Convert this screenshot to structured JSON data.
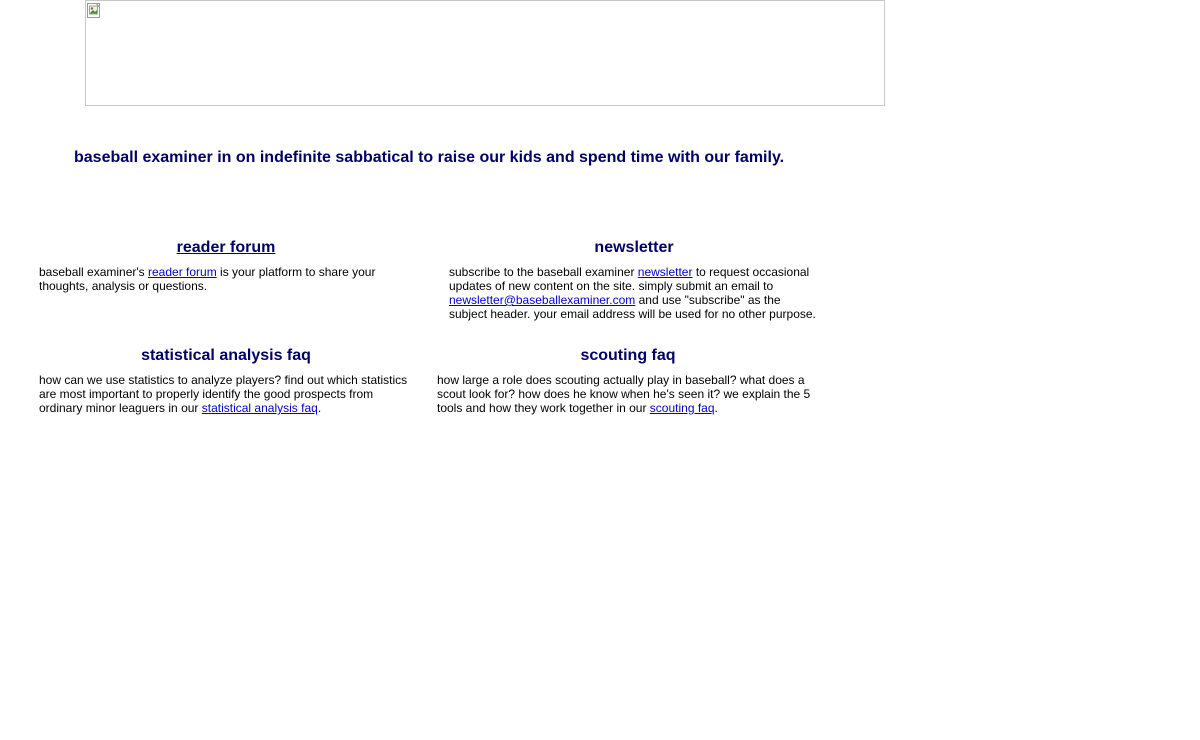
{
  "headline": "baseball examiner in on indefinite sabbatical to raise our kids and spend time with our family.",
  "banner": {
    "icon": "broken-image-icon"
  },
  "sections": {
    "forum": {
      "title": "reader forum",
      "text_before": "baseball examiner's ",
      "link": "reader forum",
      "text_after": " is your platform to share your thoughts, analysis or questions."
    },
    "newsletter": {
      "title": "newsletter",
      "text_before": "subscribe to the baseball examiner ",
      "link": "newsletter",
      "text_middle": " to request occasional updates of new content on the site. simply submit an email to ",
      "email": "newsletter@baseballexaminer.com",
      "text_after": " and use \"subscribe\" as the subject header. your email address will be used for no other purpose."
    },
    "stats": {
      "title": "statistical analysis faq",
      "text_before": "how can we use statistics to analyze players? find out which statistics are most important to properly identify the good prospects from ordinary minor leaguers in our ",
      "link": "statistical analysis faq",
      "text_after": "."
    },
    "scouting": {
      "title": "scouting faq",
      "text_before": "how large a role does scouting actually play in baseball? what does a scout look for? how does he know when he's seen it? we explain the 5 tools and how they work together in our ",
      "link": "scouting faq",
      "text_after": "."
    }
  }
}
